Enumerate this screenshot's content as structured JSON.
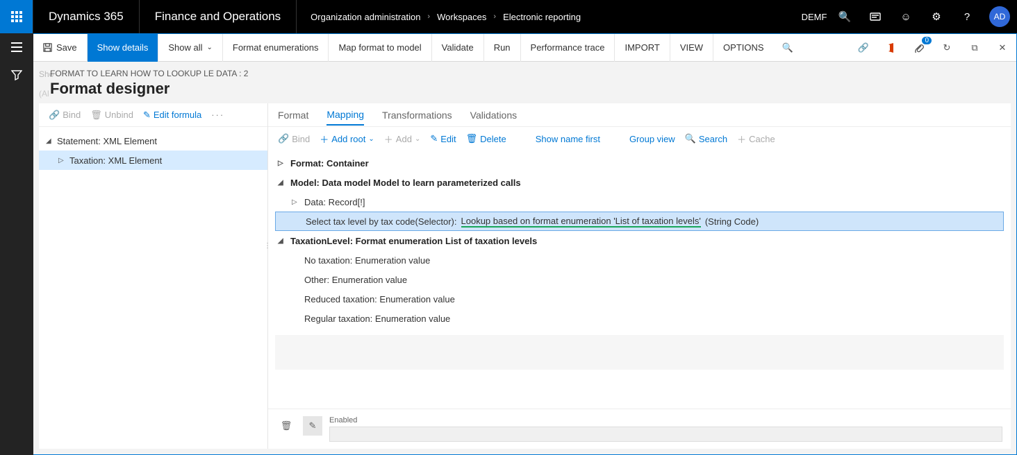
{
  "top": {
    "brand": "Dynamics 365",
    "module": "Finance and Operations",
    "crumbs": [
      "Organization administration",
      "Workspaces",
      "Electronic reporting"
    ],
    "entity": "DEMF",
    "avatar": "AD"
  },
  "actionbar": {
    "save": "Save",
    "show_details": "Show details",
    "show_all": "Show all",
    "format_enum": "Format enumerations",
    "map_model": "Map format to model",
    "validate": "Validate",
    "run": "Run",
    "perf": "Performance trace",
    "import": "IMPORT",
    "view": "VIEW",
    "options": "OPTIONS",
    "badge": "0"
  },
  "page": {
    "context": "FORMAT TO LEARN HOW TO LOOKUP LE DATA : 2",
    "title": "Format designer",
    "faint1": "Sho",
    "faint2": "(Al"
  },
  "left_tools": {
    "bind": "Bind",
    "unbind": "Unbind",
    "edit_formula": "Edit formula"
  },
  "left_tree": {
    "root": "Statement: XML Element",
    "child": "Taxation: XML Element"
  },
  "tabs": {
    "format": "Format",
    "mapping": "Mapping",
    "transforms": "Transformations",
    "valid": "Validations"
  },
  "map_tools": {
    "bind": "Bind",
    "add_root": "Add root",
    "add": "Add",
    "edit": "Edit",
    "delete": "Delete",
    "show_name": "Show name first",
    "group": "Group view",
    "search": "Search",
    "cache": "Cache"
  },
  "map_tree": {
    "n0": "Format: Container",
    "n1": "Model: Data model Model to learn parameterized calls",
    "n1a": "Data: Record[!]",
    "n1b_pre": "Select tax level by tax code(Selector): ",
    "n1b_under": "Lookup based on format enumeration 'List of taxation levels'",
    "n1b_post": " (String Code)",
    "n2": "TaxationLevel: Format enumeration List of taxation levels",
    "n2a": "No taxation: Enumeration value",
    "n2b": "Other: Enumeration value",
    "n2c": "Reduced taxation: Enumeration value",
    "n2d": "Regular taxation: Enumeration value"
  },
  "footer": {
    "enabled": "Enabled"
  }
}
